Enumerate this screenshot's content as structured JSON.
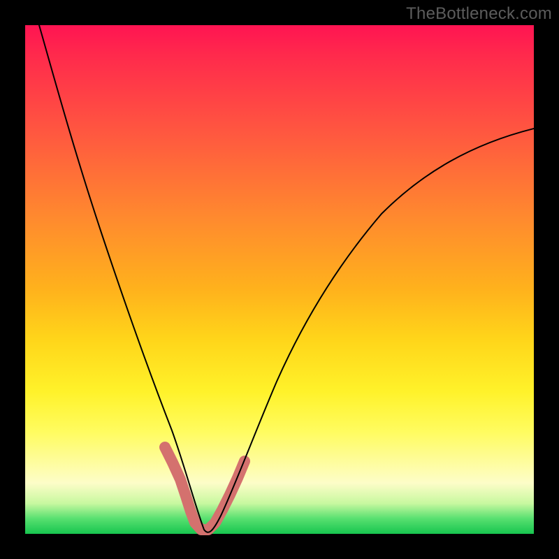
{
  "watermark": {
    "text": "TheBottleneck.com"
  },
  "chart_data": {
    "type": "line",
    "title": "",
    "xlabel": "",
    "ylabel": "",
    "x_range": [
      0,
      100
    ],
    "y_range": [
      0,
      100
    ],
    "grid": false,
    "legend": false,
    "background": "rainbow-vertical-gradient",
    "series": [
      {
        "name": "bottleneck-curve",
        "stroke": "#000000",
        "x": [
          3,
          6,
          9,
          12,
          15,
          18,
          21,
          24,
          27,
          29,
          31,
          33,
          34,
          35,
          36,
          38,
          40,
          43,
          46,
          50,
          55,
          60,
          66,
          72,
          78,
          85,
          92,
          100
        ],
        "y": [
          100,
          90,
          80,
          70,
          60,
          50,
          41,
          32,
          23,
          16,
          10,
          5,
          2,
          0,
          0,
          2,
          6,
          12,
          20,
          29,
          38,
          47,
          55,
          62,
          68,
          73,
          77,
          80
        ]
      },
      {
        "name": "valley-highlight",
        "stroke": "#d4716e",
        "x": [
          29,
          31,
          33,
          34,
          35,
          36,
          38,
          40,
          42
        ],
        "y": [
          14,
          9,
          4,
          1,
          0,
          0,
          1,
          4,
          9
        ]
      }
    ],
    "notes": "Black curve dips from top-left to a V-shaped minimum at roughly x≈35, then rises toward the right edge ending around y≈80. Valley floor is traced with a thick salmon stroke. Background is a vertical rainbow gradient (red top → green bottom). Values estimated from pixels; no axis ticks or labels are shown."
  }
}
